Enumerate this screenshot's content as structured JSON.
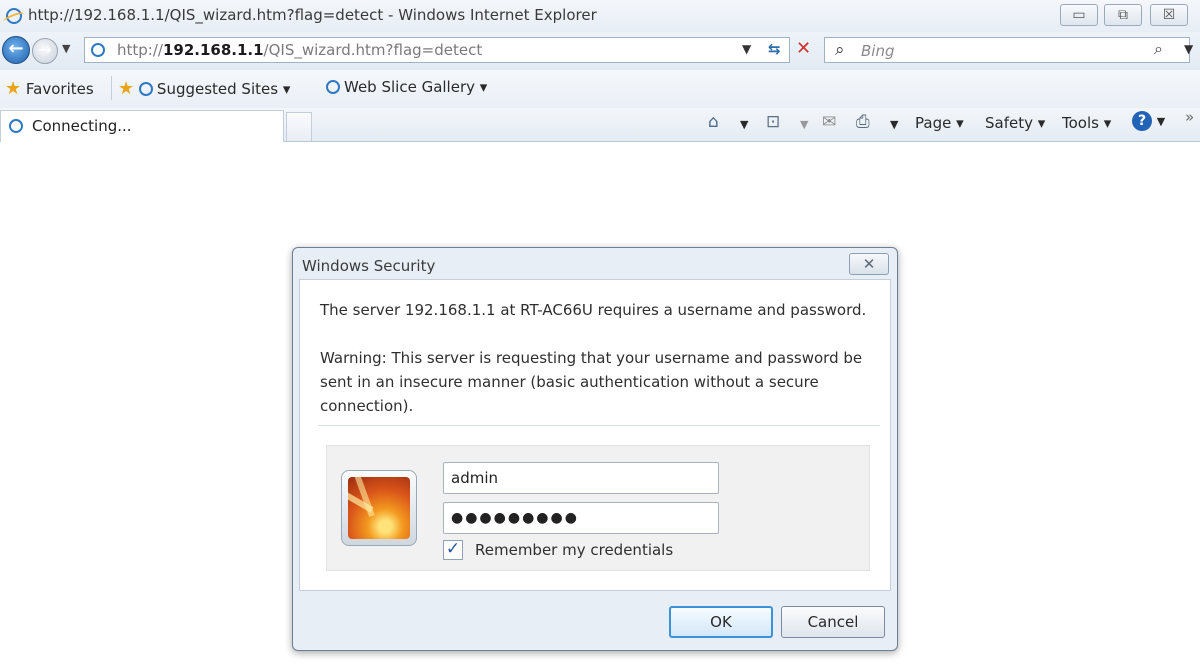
{
  "window": {
    "title": "http://192.168.1.1/QIS_wizard.htm?flag=detect - Windows Internet Explorer",
    "minimize": "▭",
    "restore": "⧉",
    "close": "☒"
  },
  "address_bar": {
    "url_prefix": "http://",
    "url_host": "192.168.1.1",
    "url_path": "/QIS_wizard.htm?flag=detect",
    "search_placeholder": "Bing"
  },
  "favorites_bar": {
    "favorites_label": "Favorites",
    "suggested_sites_label": "Suggested Sites ▾",
    "web_slice_gallery_label": "Web Slice Gallery ▾"
  },
  "tab": {
    "label": "Connecting..."
  },
  "command_bar": {
    "page_label": "Page ▾",
    "safety_label": "Safety ▾",
    "tools_label": "Tools ▾",
    "overflow": "»"
  },
  "dialog": {
    "title": "Windows Security",
    "message": "The server 192.168.1.1 at RT-AC66U requires a username and password.",
    "warning": "Warning: This server is requesting that your username and password be sent in an insecure manner (basic authentication without a secure connection).",
    "username_value": "admin",
    "password_mask": "●●●●●●●●●",
    "remember_label": "Remember my credentials",
    "remember_checked": true,
    "ok_label": "OK",
    "cancel_label": "Cancel"
  },
  "icons": [
    "ie-logo-icon",
    "back-arrow-icon",
    "forward-arrow-icon",
    "refresh-icon",
    "stop-icon",
    "search-icon",
    "favorites-star-icon",
    "home-icon",
    "rss-feed-icon",
    "read-mail-icon",
    "print-icon",
    "help-icon",
    "user-tile-icon"
  ]
}
